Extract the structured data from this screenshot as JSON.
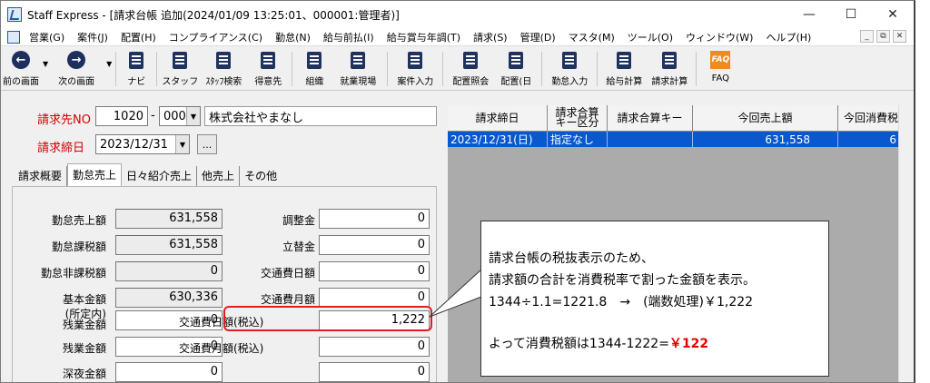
{
  "window": {
    "title": "Staff Express - [請求台帳 追加(2024/01/09 13:25:01、000001:管理者)]",
    "minimize": "—",
    "maximize": "☐",
    "close": "✕"
  },
  "menu": [
    "営業(G)",
    "案件(J)",
    "配置(H)",
    "コンプライアンス(C)",
    "勤怠(N)",
    "給与前払(I)",
    "給与賞与年調(T)",
    "請求(S)",
    "管理(D)",
    "マスタ(M)",
    "ツール(O)",
    "ウィンドウ(W)",
    "ヘルプ(H)"
  ],
  "mdi_buttons": [
    "_",
    "⧉",
    "✕"
  ],
  "toolbar": [
    {
      "label": "前の画面",
      "icon": "back-icon"
    },
    {
      "label": "次の画面",
      "icon": "forward-icon"
    },
    {
      "label": "ナビ",
      "icon": "navi-icon"
    },
    {
      "label": "スタッフ",
      "icon": "staff-icon"
    },
    {
      "label": "ｽﾀｯﾌ検索",
      "icon": "staff-search-icon"
    },
    {
      "label": "得意先",
      "icon": "customer-icon"
    },
    {
      "label": "組織",
      "icon": "organization-icon"
    },
    {
      "label": "就業現場",
      "icon": "workplace-icon"
    },
    {
      "label": "案件入力",
      "icon": "case-entry-icon"
    },
    {
      "label": "配置照会",
      "icon": "assignment-inquiry-icon"
    },
    {
      "label": "配置(日",
      "icon": "assignment-daily-icon"
    },
    {
      "label": "勤怠入力",
      "icon": "attendance-entry-icon"
    },
    {
      "label": "給与計算",
      "icon": "payroll-icon"
    },
    {
      "label": "請求計算",
      "icon": "billing-calc-icon"
    },
    {
      "label": "FAQ",
      "icon": "faq-icon"
    }
  ],
  "form": {
    "billing_to_label": "請求先NO",
    "billing_to_code": "1020",
    "billing_to_sep": "-",
    "billing_to_branch": "000",
    "billing_to_name": "株式会社やまなし",
    "closing_date_label": "請求締日",
    "closing_date": "2023/12/31",
    "ellipsis": "..."
  },
  "tabs": [
    "請求概要",
    "勤怠売上",
    "日々紹介売上",
    "他売上",
    "その他"
  ],
  "left_fields": [
    {
      "label": "勤怠売上額",
      "value": "631,558"
    },
    {
      "label": "勤怠課税額",
      "value": "631,558"
    },
    {
      "label": "勤怠非課税額",
      "value": "0"
    },
    {
      "label": "基本金額",
      "value": "630,336"
    },
    {
      "label": "(所定内)\n残業金額",
      "value": "0"
    },
    {
      "label": "残業金額",
      "value": "0"
    },
    {
      "label": "深夜金額",
      "value": "0"
    }
  ],
  "right_fields": [
    {
      "label": "調整金",
      "value": "0"
    },
    {
      "label": "立替金",
      "value": "0"
    },
    {
      "label": "交通費日額",
      "value": "0"
    },
    {
      "label": "交通費月額",
      "value": "0"
    },
    {
      "label": "交通費日額(税込)",
      "value": "1,222"
    },
    {
      "label": "交通費月額(税込)",
      "value": "0"
    },
    {
      "label": "",
      "value": "0"
    }
  ],
  "grid": {
    "headers": [
      "請求締日",
      "請求合算\nキー区分",
      "請求合算キー",
      "今回売上額",
      "今回消費税"
    ],
    "rows": [
      [
        "2023/12/31(日)",
        "指定なし",
        "",
        "631,558",
        "6"
      ]
    ]
  },
  "callout": {
    "line1": "請求台帳の税抜表示のため、",
    "line2": "請求額の合計を消費税率で割った金額を表示。",
    "line3": "1344÷1.1=1221.8　→　(端数処理)￥1,222",
    "line4_prefix": "よって消費税額は1344-1222=",
    "line4_tax": "￥122"
  },
  "colors": {
    "required_label": "#d40000",
    "grid_selection": "#0a58d0",
    "highlight_frame": "#e02020",
    "tax_text": "#e60000"
  }
}
